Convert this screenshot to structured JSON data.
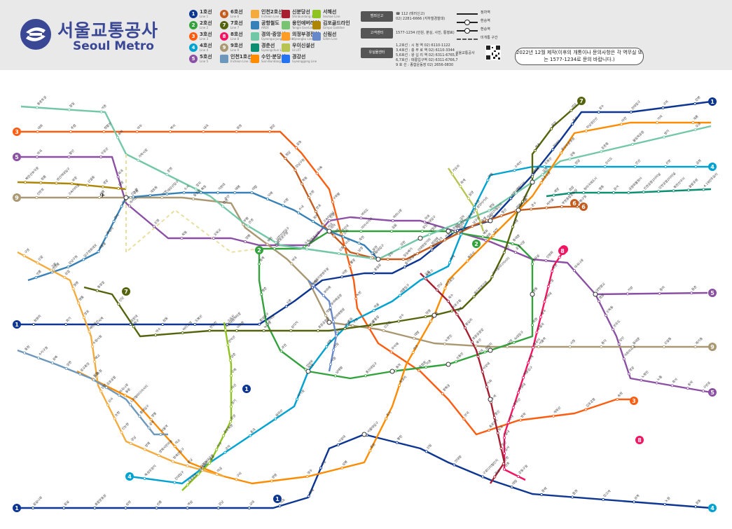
{
  "logo": {
    "name_ko": "서울교통공사",
    "name_en": "Seoul Metro",
    "mark": "seoul-metro-s-logo-icon"
  },
  "legend": [
    {
      "badge": "1",
      "ko": "1호선",
      "en": "Line 1",
      "color": "#0d3692"
    },
    {
      "badge": "2",
      "ko": "2호선",
      "en": "Line 2",
      "color": "#33a23d"
    },
    {
      "badge": "3",
      "ko": "3호선",
      "en": "Line 3",
      "color": "#fe5d10"
    },
    {
      "badge": "4",
      "ko": "4호선",
      "en": "Line 4",
      "color": "#00a2d1"
    },
    {
      "badge": "5",
      "ko": "5호선",
      "en": "Line 5",
      "color": "#8b50a4"
    },
    {
      "badge": "6",
      "ko": "6호선",
      "en": "Line 6",
      "color": "#c55c1d"
    },
    {
      "badge": "7",
      "ko": "7호선",
      "en": "Line 7",
      "color": "#54640d"
    },
    {
      "badge": "8",
      "ko": "8호선",
      "en": "Line 8",
      "color": "#f51361"
    },
    {
      "badge": "9",
      "ko": "9호선",
      "en": "Line 9",
      "color": "#aa9872"
    },
    {
      "badge": "",
      "ko": "인천1호선",
      "en": "Incheon Line 1",
      "color": "#6e98bb"
    },
    {
      "badge": "",
      "ko": "인천2호선",
      "en": "Incheon Line 2",
      "color": "#f4ab3e"
    },
    {
      "badge": "",
      "ko": "공항철도",
      "en": "AREX",
      "color": "#3681b7"
    },
    {
      "badge": "",
      "ko": "경의·중앙선",
      "en": "Gyeongui·Jungang Line",
      "color": "#72c7a6"
    },
    {
      "badge": "",
      "ko": "경춘선",
      "en": "Gyeongchun Line",
      "color": "#0c8e72"
    },
    {
      "badge": "",
      "ko": "수인·분당선",
      "en": "Suin·Bundang Line",
      "color": "#ff8c00"
    },
    {
      "badge": "",
      "ko": "신분당선",
      "en": "Shinbundang Line",
      "color": "#a71e31"
    },
    {
      "badge": "",
      "ko": "용인에버라인",
      "en": "Yongin EverLine",
      "color": "#77c371"
    },
    {
      "badge": "",
      "ko": "의정부경전철",
      "en": "Uijeongbu Line",
      "color": "#ff9d27"
    },
    {
      "badge": "",
      "ko": "우이신설선",
      "en": "Ui LRT",
      "color": "#b7c452"
    },
    {
      "badge": "",
      "ko": "경강선",
      "en": "Gyeonggang Line",
      "color": "#2673f2"
    },
    {
      "badge": "",
      "ko": "서해선",
      "en": "Seohae Line",
      "color": "#8fc31f"
    },
    {
      "badge": "",
      "ko": "김포골드라인",
      "en": "Gimpo Goldline",
      "color": "#ad8605"
    },
    {
      "badge": "",
      "ko": "신림선",
      "en": "Sillim Line",
      "color": "#6789ca"
    }
  ],
  "info": {
    "btn1": "범죄신고",
    "line1a": "☎ 112 (테러신고)",
    "line1b": "02) 2281-6666 (지하철경찰대)",
    "btn2": "고객센터",
    "line2": "1577-1234 (민원, 분실, 사진, 통행료)",
    "btn3": "유실물센터",
    "lost": [
      "1,2호선 : 시 청 역 02) 6110-1122",
      "3,4호선 : 충 무 로 역 02) 6110-3344",
      "5,6호선 : 왕 십 리 역 02) 6311-6765,6",
      "6,7호선 : 태릉입구역 02) 6311-6766,7",
      "9 호 선 : 종합운동장 02) 2656-0830"
    ]
  },
  "keys": [
    {
      "label": "정차역",
      "type": "plain"
    },
    {
      "label": "환승역",
      "type": "dot"
    },
    {
      "label": "환승역",
      "type": "dot"
    },
    {
      "label": "미개통 구간",
      "type": "dash"
    }
  ],
  "qr_logo": "서울교통공사",
  "notice": "2022년 12월 제작(이후의 개통이나 문의사항은 각 역무실 또는 1577-1234로 문의 바랍니다.)",
  "map": {
    "colors": {
      "l1": "#0d3692",
      "l2": "#33a23d",
      "l3": "#fe5d10",
      "l4": "#00a2d1",
      "l5": "#8b50a4",
      "l6": "#c55c1d",
      "l7": "#54640d",
      "l8": "#f51361",
      "l9": "#aa9872",
      "gj": "#72c7a6",
      "bd": "#ff8c00",
      "sbd": "#a71e31",
      "arex": "#3681b7",
      "ic2": "#f4ab3e",
      "ic1": "#6e98bb",
      "gc": "#0c8e72",
      "ui": "#b7c452",
      "gimpo": "#ad8605",
      "sl": "#6789ca",
      "sh": "#8fc31f"
    },
    "badges": [
      {
        "text": "3",
        "color": "#fe5d10"
      },
      {
        "text": "5",
        "color": "#8b50a4"
      },
      {
        "text": "9",
        "color": "#aa9872"
      },
      {
        "text": "1",
        "color": "#0d3692"
      },
      {
        "text": "4",
        "color": "#00a2d1"
      },
      {
        "text": "7",
        "color": "#54640d"
      },
      {
        "text": "2",
        "color": "#33a23d"
      },
      {
        "text": "6",
        "color": "#c55c1d"
      },
      {
        "text": "8",
        "color": "#f51361"
      },
      {
        "text": "1",
        "color": "#0d3692"
      },
      {
        "text": "4",
        "color": "#00a2d1"
      },
      {
        "text": "5",
        "color": "#8b50a4"
      },
      {
        "text": "9",
        "color": "#aa9872"
      },
      {
        "text": "3",
        "color": "#fe5d10"
      },
      {
        "text": "5",
        "color": "#8b50a4"
      },
      {
        "text": "8",
        "color": "#f51361"
      },
      {
        "text": "1",
        "color": "#0d3692"
      },
      {
        "text": "1",
        "color": "#0d3692"
      },
      {
        "text": "1",
        "color": "#0d3692"
      },
      {
        "text": "7",
        "color": "#54640d"
      },
      {
        "text": "2",
        "color": "#33a23d"
      },
      {
        "text": "4",
        "color": "#00a2d1"
      },
      {
        "text": "6",
        "color": "#c55c1d"
      },
      {
        "text": "8",
        "color": "#f51361"
      }
    ],
    "stations": [
      "대화",
      "주엽",
      "정발산",
      "마두",
      "백석",
      "대곡",
      "화정",
      "원당",
      "삼송",
      "지축",
      "구파발",
      "연신내",
      "불광",
      "녹번",
      "홍제",
      "무악재",
      "독립문",
      "경복궁",
      "안국",
      "종로3가",
      "방화",
      "개화산",
      "김포공항",
      "송정",
      "마곡",
      "발산",
      "우장산",
      "화곡",
      "까치산",
      "신정",
      "목동",
      "오목교",
      "양평",
      "영등포구청",
      "영등포시장",
      "신길",
      "여의도",
      "여의나루",
      "마포",
      "공덕",
      "개화",
      "공항시장",
      "신방화",
      "마곡나루",
      "양천향교",
      "가양",
      "증미",
      "등촌",
      "염창",
      "신목동",
      "선유도",
      "당산",
      "국회의사당",
      "샛강",
      "노량진",
      "노들",
      "흑석",
      "동작",
      "구반포",
      "신반포",
      "고속터미널",
      "사평",
      "신논현",
      "인천",
      "동인천",
      "주안",
      "부평",
      "부천",
      "역곡",
      "온수",
      "개봉",
      "구로",
      "신도림",
      "대방",
      "노량진",
      "용산",
      "남영",
      "서울역",
      "시청",
      "종각",
      "동대문",
      "신설동",
      "제기동",
      "청량리",
      "회기",
      "석계",
      "광운대",
      "창동",
      "도봉산",
      "소요산",
      "홍대입구",
      "신촌",
      "이대",
      "아현",
      "충정로",
      "을지로입구",
      "을지로3가",
      "동대문역사문화공원",
      "신당",
      "상왕십리",
      "왕십리",
      "한양대",
      "뚝섬",
      "성수",
      "건대입구",
      "구의",
      "강변",
      "잠실나루",
      "잠실",
      "종합운동장",
      "삼성",
      "선릉",
      "역삼",
      "강남",
      "교대",
      "서초",
      "방배",
      "사당",
      "낙성대",
      "서울대입구",
      "봉천",
      "신림",
      "신대방",
      "구로디지털단지",
      "대림",
      "문래",
      "합정",
      "당고개",
      "상계",
      "노원",
      "창동",
      "쌍문",
      "수유",
      "미아",
      "미아사거리",
      "길음",
      "성신여대입구",
      "한성대입구",
      "혜화",
      "동대문",
      "충무로",
      "명동",
      "회현",
      "숙대입구",
      "삼각지",
      "신용산",
      "이촌",
      "동작",
      "총신대입구",
      "남태령",
      "선바위",
      "과천",
      "인덕원",
      "평촌",
      "범계",
      "금정",
      "산본",
      "안산",
      "오이도",
      "장암",
      "도봉산",
      "수락산",
      "마들",
      "노원",
      "중계",
      "하계",
      "공릉",
      "태릉입구",
      "먹골",
      "중화",
      "상봉",
      "면목",
      "사가정",
      "용마산",
      "중곡",
      "군자",
      "어린이대공원",
      "건대입구",
      "뚝섬유원지",
      "청담",
      "강남구청",
      "학동",
      "논현",
      "반포",
      "고속터미널",
      "내방",
      "이수",
      "남성",
      "숭실대입구",
      "상도",
      "장승배기",
      "신대방삼거리",
      "보라매",
      "신풍",
      "대림",
      "남구로",
      "가산디지털단지",
      "철산",
      "광명사거리",
      "온수",
      "까치울",
      "부천종합운동장",
      "부평구청",
      "석남",
      "응암",
      "역촌",
      "독바위",
      "구산",
      "새절",
      "증산",
      "디지털미디어시티",
      "월드컵경기장",
      "마포구청",
      "망원",
      "상수",
      "광흥창",
      "대흥",
      "효창공원앞",
      "삼각지",
      "녹사평",
      "이태원",
      "한강진",
      "버티고개",
      "약수",
      "청구",
      "신당",
      "동묘앞",
      "창신",
      "보문",
      "안암",
      "고려대",
      "월곡",
      "상월곡",
      "돌곶이",
      "석계",
      "태릉입구",
      "화랑대",
      "봉화산",
      "신내",
      "별내",
      "암사",
      "천호",
      "강동구청",
      "몽촌토성",
      "잠실",
      "석촌",
      "송파",
      "가락시장",
      "문정",
      "장지",
      "복정",
      "산성",
      "남한산성입구",
      "단대오거리",
      "신흥",
      "수진",
      "모란",
      "상일동",
      "고덕",
      "명일",
      "굽은다리",
      "길동",
      "강동",
      "둔촌동",
      "올림픽공원",
      "방이",
      "오금",
      "개롱",
      "거여",
      "마천",
      "하남검단산",
      "중앙보훈병원",
      "둔촌오륜",
      "석촌고분",
      "삼전",
      "봉은사",
      "삼성중앙",
      "선정릉",
      "언주",
      "청량리",
      "회기",
      "중랑",
      "상봉",
      "망우",
      "양원",
      "구리",
      "도농",
      "덕소",
      "양평",
      "용문",
      "지평",
      "서빙고",
      "한남",
      "옥수",
      "응봉",
      "왕십리",
      "효창공원앞",
      "공덕",
      "서강대",
      "가좌",
      "수색",
      "행신",
      "능곡",
      "일산",
      "탄현",
      "문산",
      "선릉",
      "선정릉",
      "강남구청",
      "압구정로데오",
      "서울숲",
      "왕십리",
      "한티",
      "도곡",
      "구룡",
      "개포동",
      "대모산입구",
      "수서",
      "복정",
      "가천대",
      "태평",
      "야탑",
      "이매",
      "서현",
      "수내",
      "정자",
      "미금",
      "오리",
      "죽전",
      "보정",
      "구성",
      "신갈",
      "기흥",
      "상갈",
      "청명",
      "영통",
      "망포",
      "매탄권선",
      "수원시청",
      "매교",
      "수원",
      "인천",
      "신사",
      "논현",
      "신논현",
      "강남",
      "양재",
      "양재시민의숲",
      "청계산입구",
      "판교",
      "정자",
      "미금",
      "동천",
      "수지구청",
      "성복",
      "상현",
      "광교중앙",
      "광교",
      "김포공항",
      "마곡나루",
      "디지털미디어시티",
      "홍대입구",
      "공덕",
      "서울역",
      "계양",
      "검암",
      "청라국제도시",
      "영종",
      "운서",
      "공항화물청사",
      "인천공항1터미널",
      "인천공항2터미널",
      "북한산우이",
      "솔밭공원",
      "4.19민주묘지",
      "가오리",
      "화계",
      "삼양",
      "삼양사거리",
      "솔샘",
      "북한산보국문",
      "정릉",
      "성신여대입구",
      "보문",
      "신설동",
      "샛강",
      "대방",
      "서울지방병무청",
      "보라매",
      "보라매공원",
      "보라매병원",
      "당곡",
      "신림",
      "서원",
      "서울대벤처타운",
      "관악산",
      "양촌",
      "구래",
      "마산",
      "장기",
      "운양",
      "걸포북변",
      "사우",
      "풍무",
      "고촌",
      "김포공항",
      "원시",
      "시우",
      "초지",
      "선부",
      "달미",
      "시흥능곡",
      "시흥시청",
      "신현",
      "신천",
      "시흥대야",
      "소새울",
      "소사",
      "부천종합운동장",
      "원종",
      "김포공항",
      "능곡",
      "대곡",
      "곡산",
      "백마",
      "풍산",
      "일산",
      "상봉",
      "망우",
      "신내",
      "갈매",
      "별내",
      "퇴계원",
      "사릉",
      "금곡",
      "평내호평",
      "천마산",
      "마석",
      "대성리",
      "청평",
      "상천",
      "가평",
      "굴봉산",
      "백양리",
      "강촌",
      "김유정",
      "남춘천",
      "춘천",
      "계양",
      "귤현",
      "박촌",
      "임학",
      "계산",
      "경인교대입구",
      "작전",
      "갈산",
      "부평구청",
      "부평시장",
      "부평",
      "동수",
      "부평삼거리",
      "간석오거리",
      "인천시청",
      "예술회관",
      "인천터미널",
      "문학경기장",
      "선학",
      "신연수",
      "원인재",
      "동춘",
      "동막",
      "캠퍼스타운",
      "테크노파크",
      "지식정보단지",
      "인천대입구",
      "센트럴파크",
      "국제업무지구",
      "송도달빛축제공원",
      "검단오류",
      "왕길",
      "검단사거리",
      "마전",
      "완정",
      "독정",
      "검암",
      "검바위",
      "아시아드경기장",
      "서구청",
      "가정",
      "가정중앙시장",
      "석남",
      "서부여성회관",
      "인천가좌",
      "가재울",
      "주안국가산단",
      "주안",
      "시민공원",
      "석바위시장",
      "인천시청",
      "석천사거리",
      "모래내시장",
      "만수",
      "남동구청",
      "인천대공원",
      "운연",
      "신창",
      "온양온천",
      "천안",
      "두정",
      "평택",
      "오산",
      "병점",
      "세마",
      "수원",
      "화서",
      "성균관대",
      "의왕",
      "당정",
      "군포",
      "금정",
      "명학",
      "안양",
      "관악",
      "석수",
      "금천구청",
      "독산",
      "가산디지털단지",
      "구일",
      "광명",
      "서동탄"
    ]
  }
}
